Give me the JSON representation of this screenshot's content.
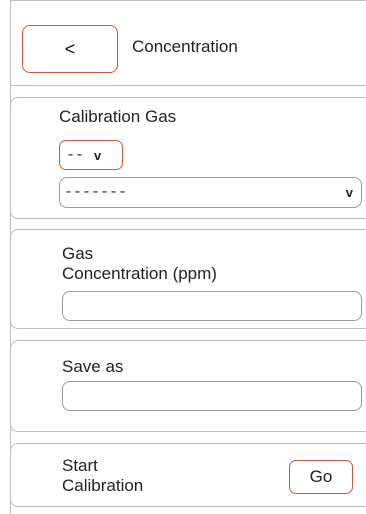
{
  "header": {
    "back_label": "<",
    "title": "Concentration"
  },
  "calibration_gas": {
    "label": "Calibration Gas",
    "type_select_value": "--",
    "type_select_chevron": "v",
    "gas_select_value": "-------",
    "gas_select_chevron": "v"
  },
  "gas_concentration": {
    "label_line1": "Gas",
    "label_line2": "Concentration (ppm)",
    "value": ""
  },
  "save_as": {
    "label": "Save as",
    "value": ""
  },
  "start_calibration": {
    "label_line1": "Start",
    "label_line2": "Calibration",
    "go_label": "Go"
  },
  "colors": {
    "accent": "#cc5a3c",
    "border": "#bdbdbd",
    "input_border": "#9a9a9a"
  }
}
